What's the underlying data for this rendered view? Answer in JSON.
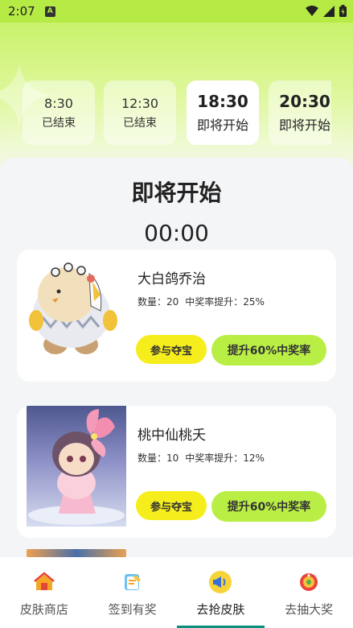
{
  "status_bar": {
    "time": "2:07",
    "app_badge": "A"
  },
  "session_tabs": [
    {
      "time": "8:30",
      "status": "已结束"
    },
    {
      "time": "12:30",
      "status": "已结束"
    },
    {
      "time": "18:30",
      "status": "即将开始"
    },
    {
      "time": "20:30",
      "status": "即将开始"
    }
  ],
  "heading": "即将开始",
  "countdown": "00:00",
  "products": [
    {
      "name": "大白鸽乔治",
      "quantity_text": "数量：20",
      "rate_text": "中奖率提升：25%",
      "join_label": "参与夺宝",
      "boost_label": "提升60%中奖率"
    },
    {
      "name": "桃中仙桃夭",
      "quantity_text": "数量：10",
      "rate_text": "中奖率提升：12%",
      "join_label": "参与夺宝",
      "boost_label": "提升60%中奖率"
    }
  ],
  "bottom_nav": [
    {
      "label": "皮肤商店",
      "icon": "shop-icon"
    },
    {
      "label": "签到有奖",
      "icon": "checkin-icon"
    },
    {
      "label": "去抢皮肤",
      "icon": "grab-skin-icon"
    },
    {
      "label": "去抽大奖",
      "icon": "lottery-icon"
    }
  ],
  "colors": {
    "accent_green": "#b9ee45",
    "join_yellow": "#f6ee1c",
    "status_bar": "#b6ea45",
    "nav_indicator": "#0a8f7f"
  }
}
